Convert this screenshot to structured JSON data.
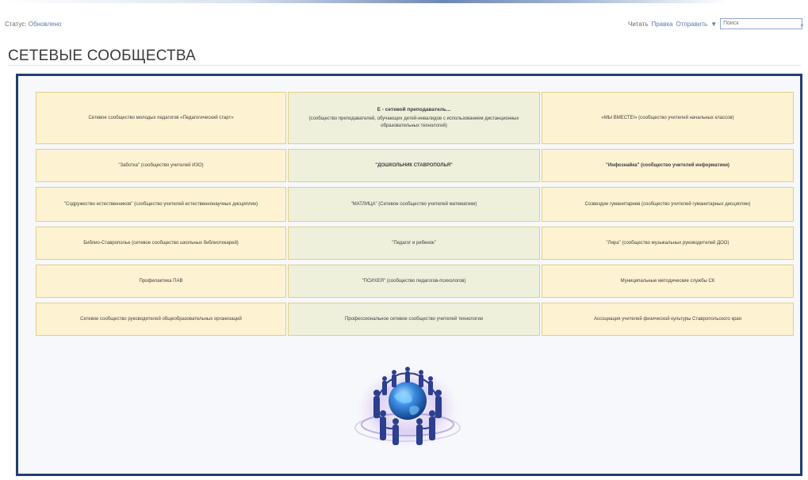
{
  "toolbar": {
    "status_label": "Статус:",
    "status_value": "Обновлено",
    "link_read": "Читать",
    "link_edit": "Правка",
    "link_other": "Отправить",
    "link_menu": "▼",
    "search_placeholder": "Поиск"
  },
  "page": {
    "title": "СЕТЕВЫЕ СООБЩЕСТВА"
  },
  "communities": {
    "rows": [
      [
        {
          "text": "Сетевое сообщество молодых педагогов «Педагогический старт»"
        },
        {
          "title": "Е - сетевой преподаватель...",
          "text": "(сообщество преподавателей, обучающих детей-инвалидов с использованием дистанционных образовательных технологий)"
        },
        {
          "text": "«МЫ ВМЕСТЕ!» (сообщество учителей начальных классов)"
        }
      ],
      [
        {
          "text": "\"Заботка\" (сообщество учителей ИЗО)"
        },
        {
          "text": "\"ДОШКОЛЬНИК СТАВРОПОЛЬЯ\""
        },
        {
          "text": "\"Инфознайка\" (сообщество учителей информатики)"
        }
      ],
      [
        {
          "text": "\"Содружество естественников\" (сообщество учителей естественнонаучных дисциплин)"
        },
        {
          "text": "\"МАТЛИЦА\" (Сетевое сообщество учителей математики)"
        },
        {
          "text": "Созвездие гуманитариев (сообщество учителей гуманитарных дисциплин)"
        }
      ],
      [
        {
          "text": "Библио-Ставрополье (сетевое сообщество школьных библиотекарей)"
        },
        {
          "text": "\"Педагог и ребенок\""
        },
        {
          "text": "\"Лира\" (сообщество музыкальных руководителей ДОО)"
        }
      ],
      [
        {
          "text": "Профилактика ПАВ"
        },
        {
          "text": "\"ПСИХЕЯ\" (сообщество педагогов-психологов)"
        },
        {
          "text": "Муниципальные методические службы СК"
        }
      ],
      [
        {
          "text": "Сетевое сообщество руководителей общеобразовательных организаций"
        },
        {
          "text": "Профессиональное сетевое сообщество учителей технологии"
        },
        {
          "text": "Ассоциация учителей физической культуры Ставропольского края"
        }
      ]
    ]
  },
  "colors": {
    "panel_border": "#1f3f74",
    "cell_fill": "#fdf3d2",
    "cell_mid_fill": "#eef0dc",
    "cell_border": "#e1cf86",
    "globe_blue": "#2a6fd1",
    "people_blue": "#2b3f8f"
  },
  "icons": {
    "globe": "globe-with-people-circle-icon",
    "search": "magnifier-icon"
  }
}
